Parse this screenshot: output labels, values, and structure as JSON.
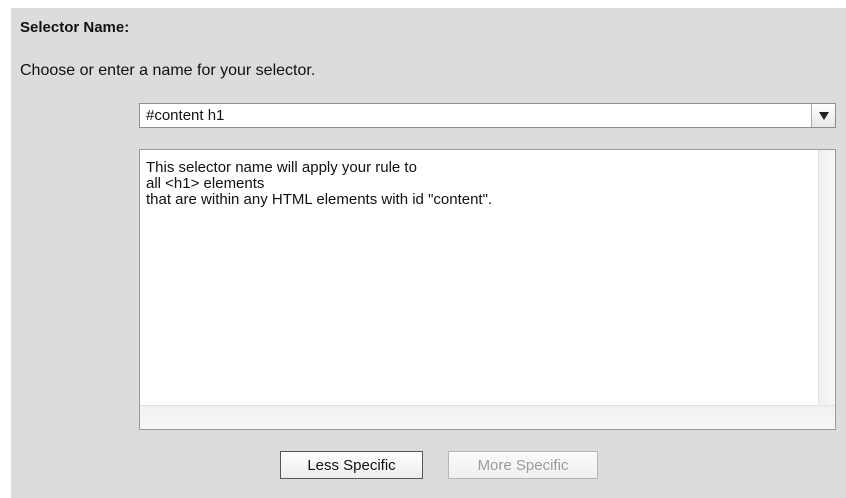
{
  "section": {
    "title": "Selector Name:",
    "instruction": "Choose or enter a name for your selector."
  },
  "selector": {
    "value": "#content h1",
    "dropdown_icon": "triangle-down-icon"
  },
  "description": {
    "lines": [
      "This selector name will apply your rule to",
      "all <h1> elements",
      "that are within any HTML elements with id \"content\"."
    ]
  },
  "buttons": {
    "less_specific": "Less Specific",
    "more_specific": "More Specific",
    "more_specific_enabled": false
  }
}
